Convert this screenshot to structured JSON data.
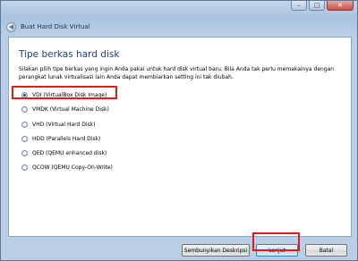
{
  "window": {
    "title": "Buat Hard Disk Virtual",
    "close_glyph": "✕",
    "minimize_glyph": "–",
    "maximize_glyph": "□",
    "back_glyph": "◀"
  },
  "page": {
    "heading": "Tipe berkas hard disk",
    "description": "Silakan pilih tipe berkas yang ingin Anda pakai untuk hard disk virtual baru. Bila Anda tak perlu memakainya dengan perangkat lunak virtualisasi lain Anda dapat membiarkan setting ini tak diubah."
  },
  "file_types": [
    {
      "label": "VDI (VirtualBox Disk Image)",
      "selected": true
    },
    {
      "label": "VMDK (Virtual Machine Disk)",
      "selected": false
    },
    {
      "label": "VHD (Virtual Hard Disk)",
      "selected": false
    },
    {
      "label": "HDD (Parallels Hard Disk)",
      "selected": false
    },
    {
      "label": "QED (QEMU enhanced disk)",
      "selected": false
    },
    {
      "label": "QCOW (QEMU Copy-On-Write)",
      "selected": false
    }
  ],
  "buttons": {
    "hide_description": "Sembunyikan Deskripsi",
    "next": "Lanjut",
    "cancel": "Batal"
  },
  "colors": {
    "heading": "#1e3d8a",
    "highlight": "#e21a1a",
    "radio_selected": "#1a4f9b"
  }
}
